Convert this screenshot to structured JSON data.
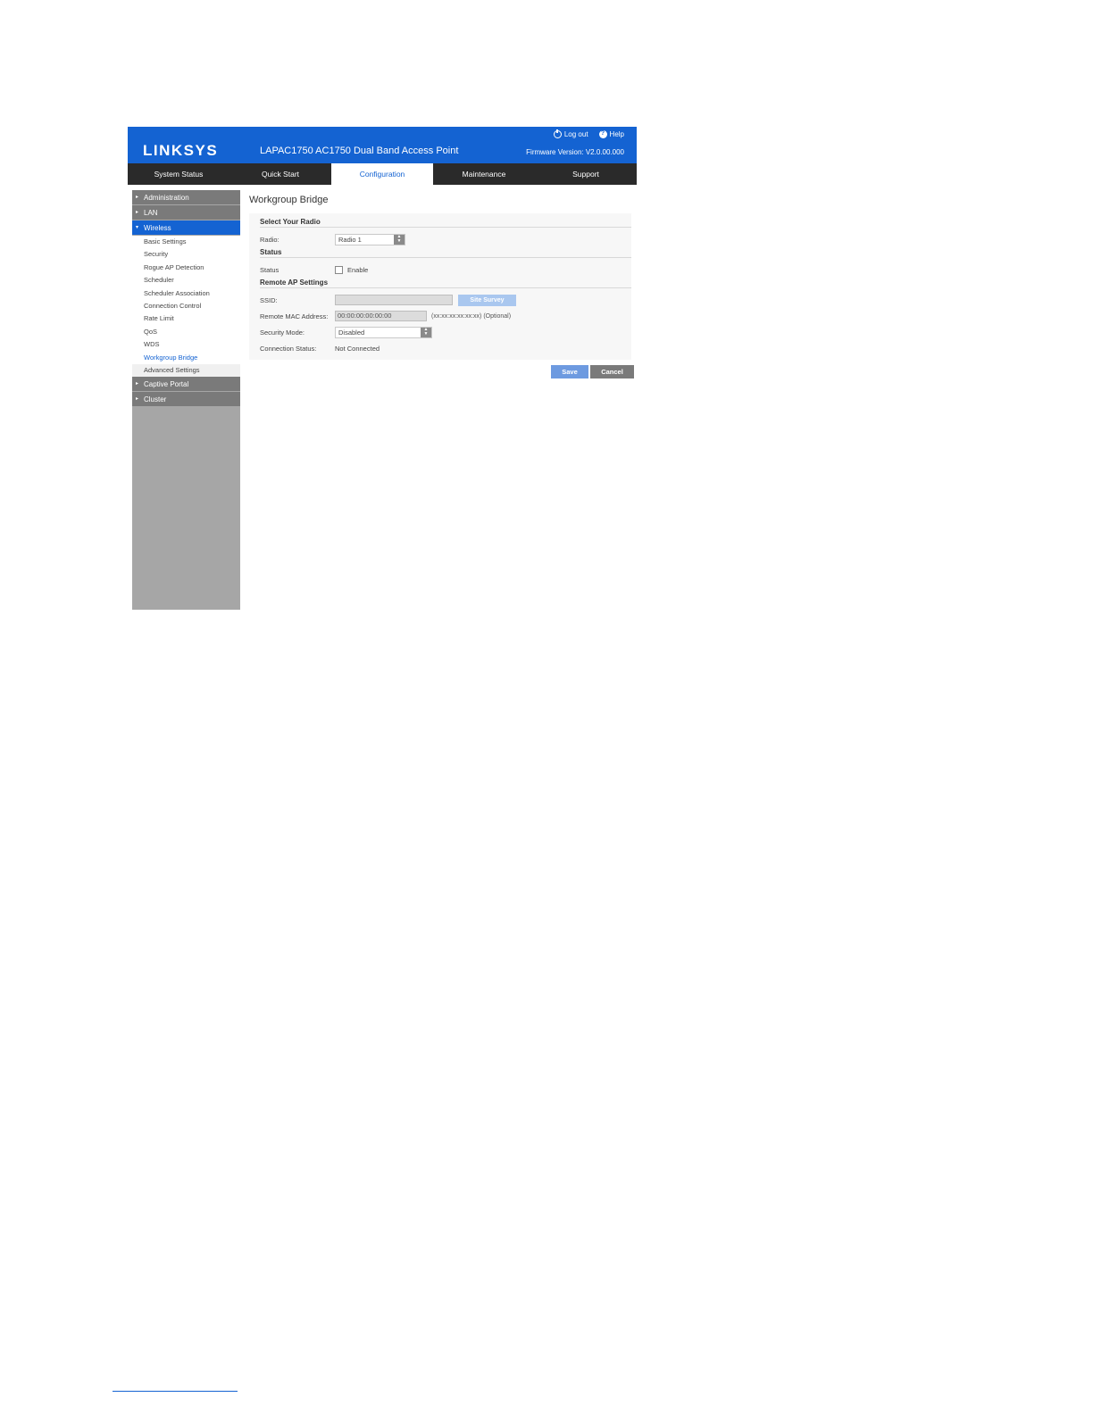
{
  "header": {
    "logo": "LINKSYS",
    "product": "LAPAC1750 AC1750 Dual Band Access Point",
    "logout_label": "Log out",
    "help_label": "Help",
    "firmware": "Firmware Version: V2.0.00.000"
  },
  "nav": {
    "tabs": [
      {
        "label": "System Status"
      },
      {
        "label": "Quick Start"
      },
      {
        "label": "Configuration"
      },
      {
        "label": "Maintenance"
      },
      {
        "label": "Support"
      }
    ]
  },
  "sidebar": {
    "administration": "Administration",
    "lan": "LAN",
    "wireless": "Wireless",
    "wireless_items": [
      "Basic Settings",
      "Security",
      "Rogue AP Detection",
      "Scheduler",
      "Scheduler Association",
      "Connection Control",
      "Rate Limit",
      "QoS",
      "WDS",
      "Workgroup Bridge",
      "Advanced Settings"
    ],
    "captive_portal": "Captive Portal",
    "cluster": "Cluster"
  },
  "main": {
    "title": "Workgroup Bridge",
    "select_radio_head": "Select Your Radio",
    "radio_label": "Radio:",
    "radio_value": "Radio 1",
    "status_head": "Status",
    "status_label": "Status",
    "enable_label": "Enable",
    "remote_head": "Remote AP Settings",
    "ssid_label": "SSID:",
    "ssid_value": "",
    "site_survey": "Site Survey",
    "mac_label": "Remote MAC Address:",
    "mac_value": "00:00:00:00:00:00",
    "mac_hint": "(xx:xx:xx:xx:xx:xx) (Optional)",
    "security_label": "Security Mode:",
    "security_value": "Disabled",
    "conn_status_label": "Connection Status:",
    "conn_status_value": "Not Connected",
    "save": "Save",
    "cancel": "Cancel"
  }
}
